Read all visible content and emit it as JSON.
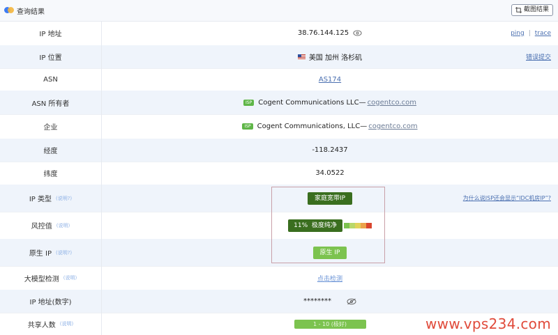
{
  "header": {
    "title": "查询结果",
    "screenshot_label": "截图结果"
  },
  "rows": {
    "ip": {
      "label": "IP 地址",
      "value": "38.76.144.125",
      "tool_ping": "ping",
      "tool_sep": "|",
      "tool_trace": "trace"
    },
    "location": {
      "label": "IP 位置",
      "value": "美国 加州 洛杉矶",
      "flag": "US",
      "action": "错误提交"
    },
    "asn": {
      "label": "ASN",
      "value": "AS174"
    },
    "asn_owner": {
      "label": "ASN 所有者",
      "badge": "ISP",
      "name": "Cogent Communications LLC—",
      "domain": "cogentco.com"
    },
    "company": {
      "label": "企业",
      "badge": "ISP",
      "name": "Cogent Communications, LLC—",
      "domain": "cogentco.com"
    },
    "longitude": {
      "label": "经度",
      "value": "-118.2437"
    },
    "latitude": {
      "label": "纬度",
      "value": "34.0522"
    },
    "ip_type": {
      "label": "IP 类型",
      "help": "(说明?)",
      "value": "家庭宽带IP",
      "question": "为什么说ISP还会显示“IDC机房IP”?"
    },
    "risk": {
      "label": "风控值",
      "help": "(说明)",
      "value": "11%  极度纯净",
      "meter_colors": [
        "#7cc34f",
        "#b9d86a",
        "#e2d35a",
        "#eba24a",
        "#d9452e"
      ]
    },
    "native": {
      "label": "原生 IP",
      "help": "(说明?)",
      "value": "原生 IP"
    },
    "llm": {
      "label": "大模型检测",
      "help": "(说明)",
      "value": "点击检测"
    },
    "ip_numeric": {
      "label": "IP 地址(数字)",
      "value": "********"
    },
    "share": {
      "label": "共享人数",
      "help": "(说明)",
      "value": "1 - 10 (极好)"
    }
  },
  "watermark": "www.vps234.com",
  "colors": {
    "accent_link": "#4a6fb0",
    "tag_dark": "#3a6e1f",
    "tag_green": "#7cc34f",
    "isp_badge": "#5fb648",
    "watermark": "#e04a3a"
  }
}
